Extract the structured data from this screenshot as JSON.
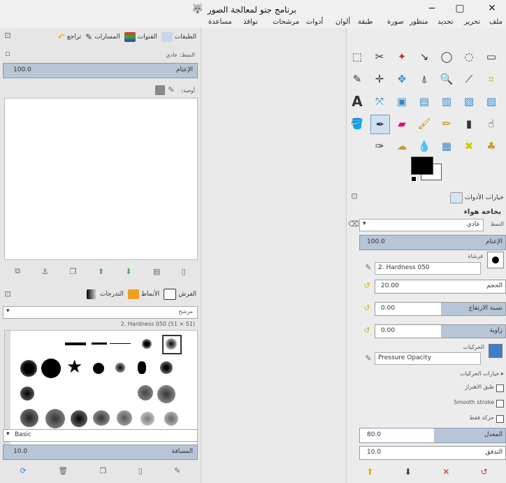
{
  "window": {
    "title": "برنامج جنو لمعالجة الصور",
    "minimize": "−",
    "maximize": "▢",
    "close": "✕"
  },
  "menu": [
    "ملف",
    "تحرير",
    "تحديد",
    "منظور",
    "صورة",
    "طبقة",
    "ألوان",
    "أدوات",
    "مرشحات",
    "نوافذ",
    "مساعدة"
  ],
  "left": {
    "tabs": [
      "الطبقات",
      "القنوات",
      "المسارات",
      "تراجع"
    ],
    "mode_label": "النمط: عادي",
    "opacity_label": "الإعتام",
    "opacity_value": "100.0",
    "lock_label": "أوصد:",
    "brush_tabs": [
      "الفرش",
      "الأنماط",
      "التدرجات"
    ],
    "filter_placeholder": "مرشح",
    "brush_name": "2. Hardness 050 (51 × 51)",
    "preset_label": "Basic",
    "spacing_label": "المسافة",
    "spacing_value": "10.0"
  },
  "right": {
    "tabs": [
      "خيارات الأدوات"
    ],
    "tool_name": "بخاخة هواء",
    "mode_label": "النمط",
    "mode_value": "عادي",
    "opacity_label": "الإعتام",
    "opacity_value": "100.0",
    "brush_label": "فرشاة",
    "brush_value": "2. Hardness 050",
    "size_label": "الحجم",
    "size_value": "20.00",
    "aspect_label": "نسبة الارتفاع",
    "aspect_value": "0.00",
    "angle_label": "زاوية",
    "angle_value": "0.00",
    "dynamics_label": "الحركيات",
    "dynamics_value": "Pressure Opacity",
    "dyn_options_label": "خيارات الحركيات",
    "apply_jitter_label": "طبق الاهتزاز",
    "smooth_stroke_label": "Smooth stroke",
    "motion_label": "حركة فقط",
    "rate_label": "المعدل",
    "rate_value": "80.0",
    "flow_label": "التدفق",
    "flow_value": "10.0"
  }
}
